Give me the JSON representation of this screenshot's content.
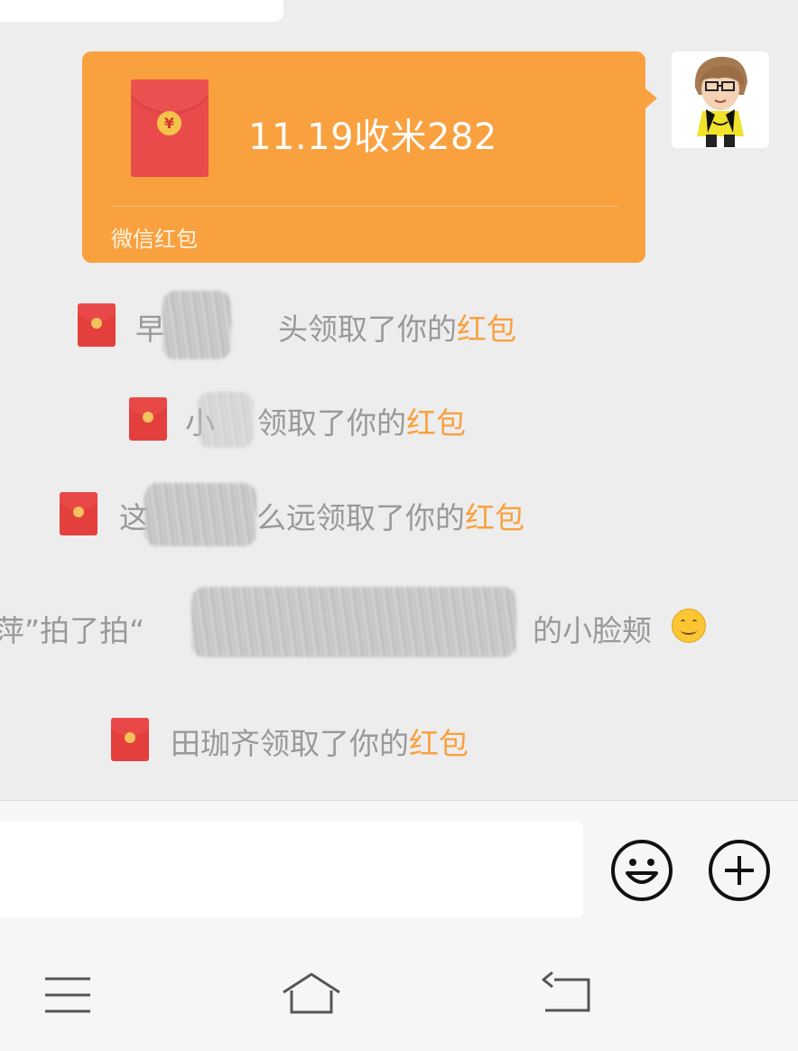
{
  "red_packet": {
    "title": "11.19收米282",
    "label": "微信红包",
    "coin_symbol": "¥",
    "bubble_color": "#f9a13f"
  },
  "system_messages": [
    {
      "name_visible": "早",
      "name_suffix": "头",
      "action": "领取了你的",
      "link": "红包"
    },
    {
      "name_visible": "小",
      "name_suffix": "",
      "action": "领取了你的",
      "link": "红包"
    },
    {
      "name_visible": "这",
      "name_suffix": "么远",
      "action": "领取了你的",
      "link": "红包"
    },
    {
      "name_visible": "田珈齐",
      "name_suffix": "",
      "action": "领取了你的",
      "link": "红包"
    }
  ],
  "pat_message": {
    "prefix": "萍”拍了拍“",
    "suffix": "的小脸颊",
    "emoji": "smiling-face-icon"
  },
  "input_bar": {
    "emoji_button_icon": "smiley-icon",
    "more_button_icon": "plus-circle-icon"
  },
  "nav_bar": {
    "menu_icon": "menu-icon",
    "home_icon": "home-icon",
    "back_icon": "back-icon"
  }
}
